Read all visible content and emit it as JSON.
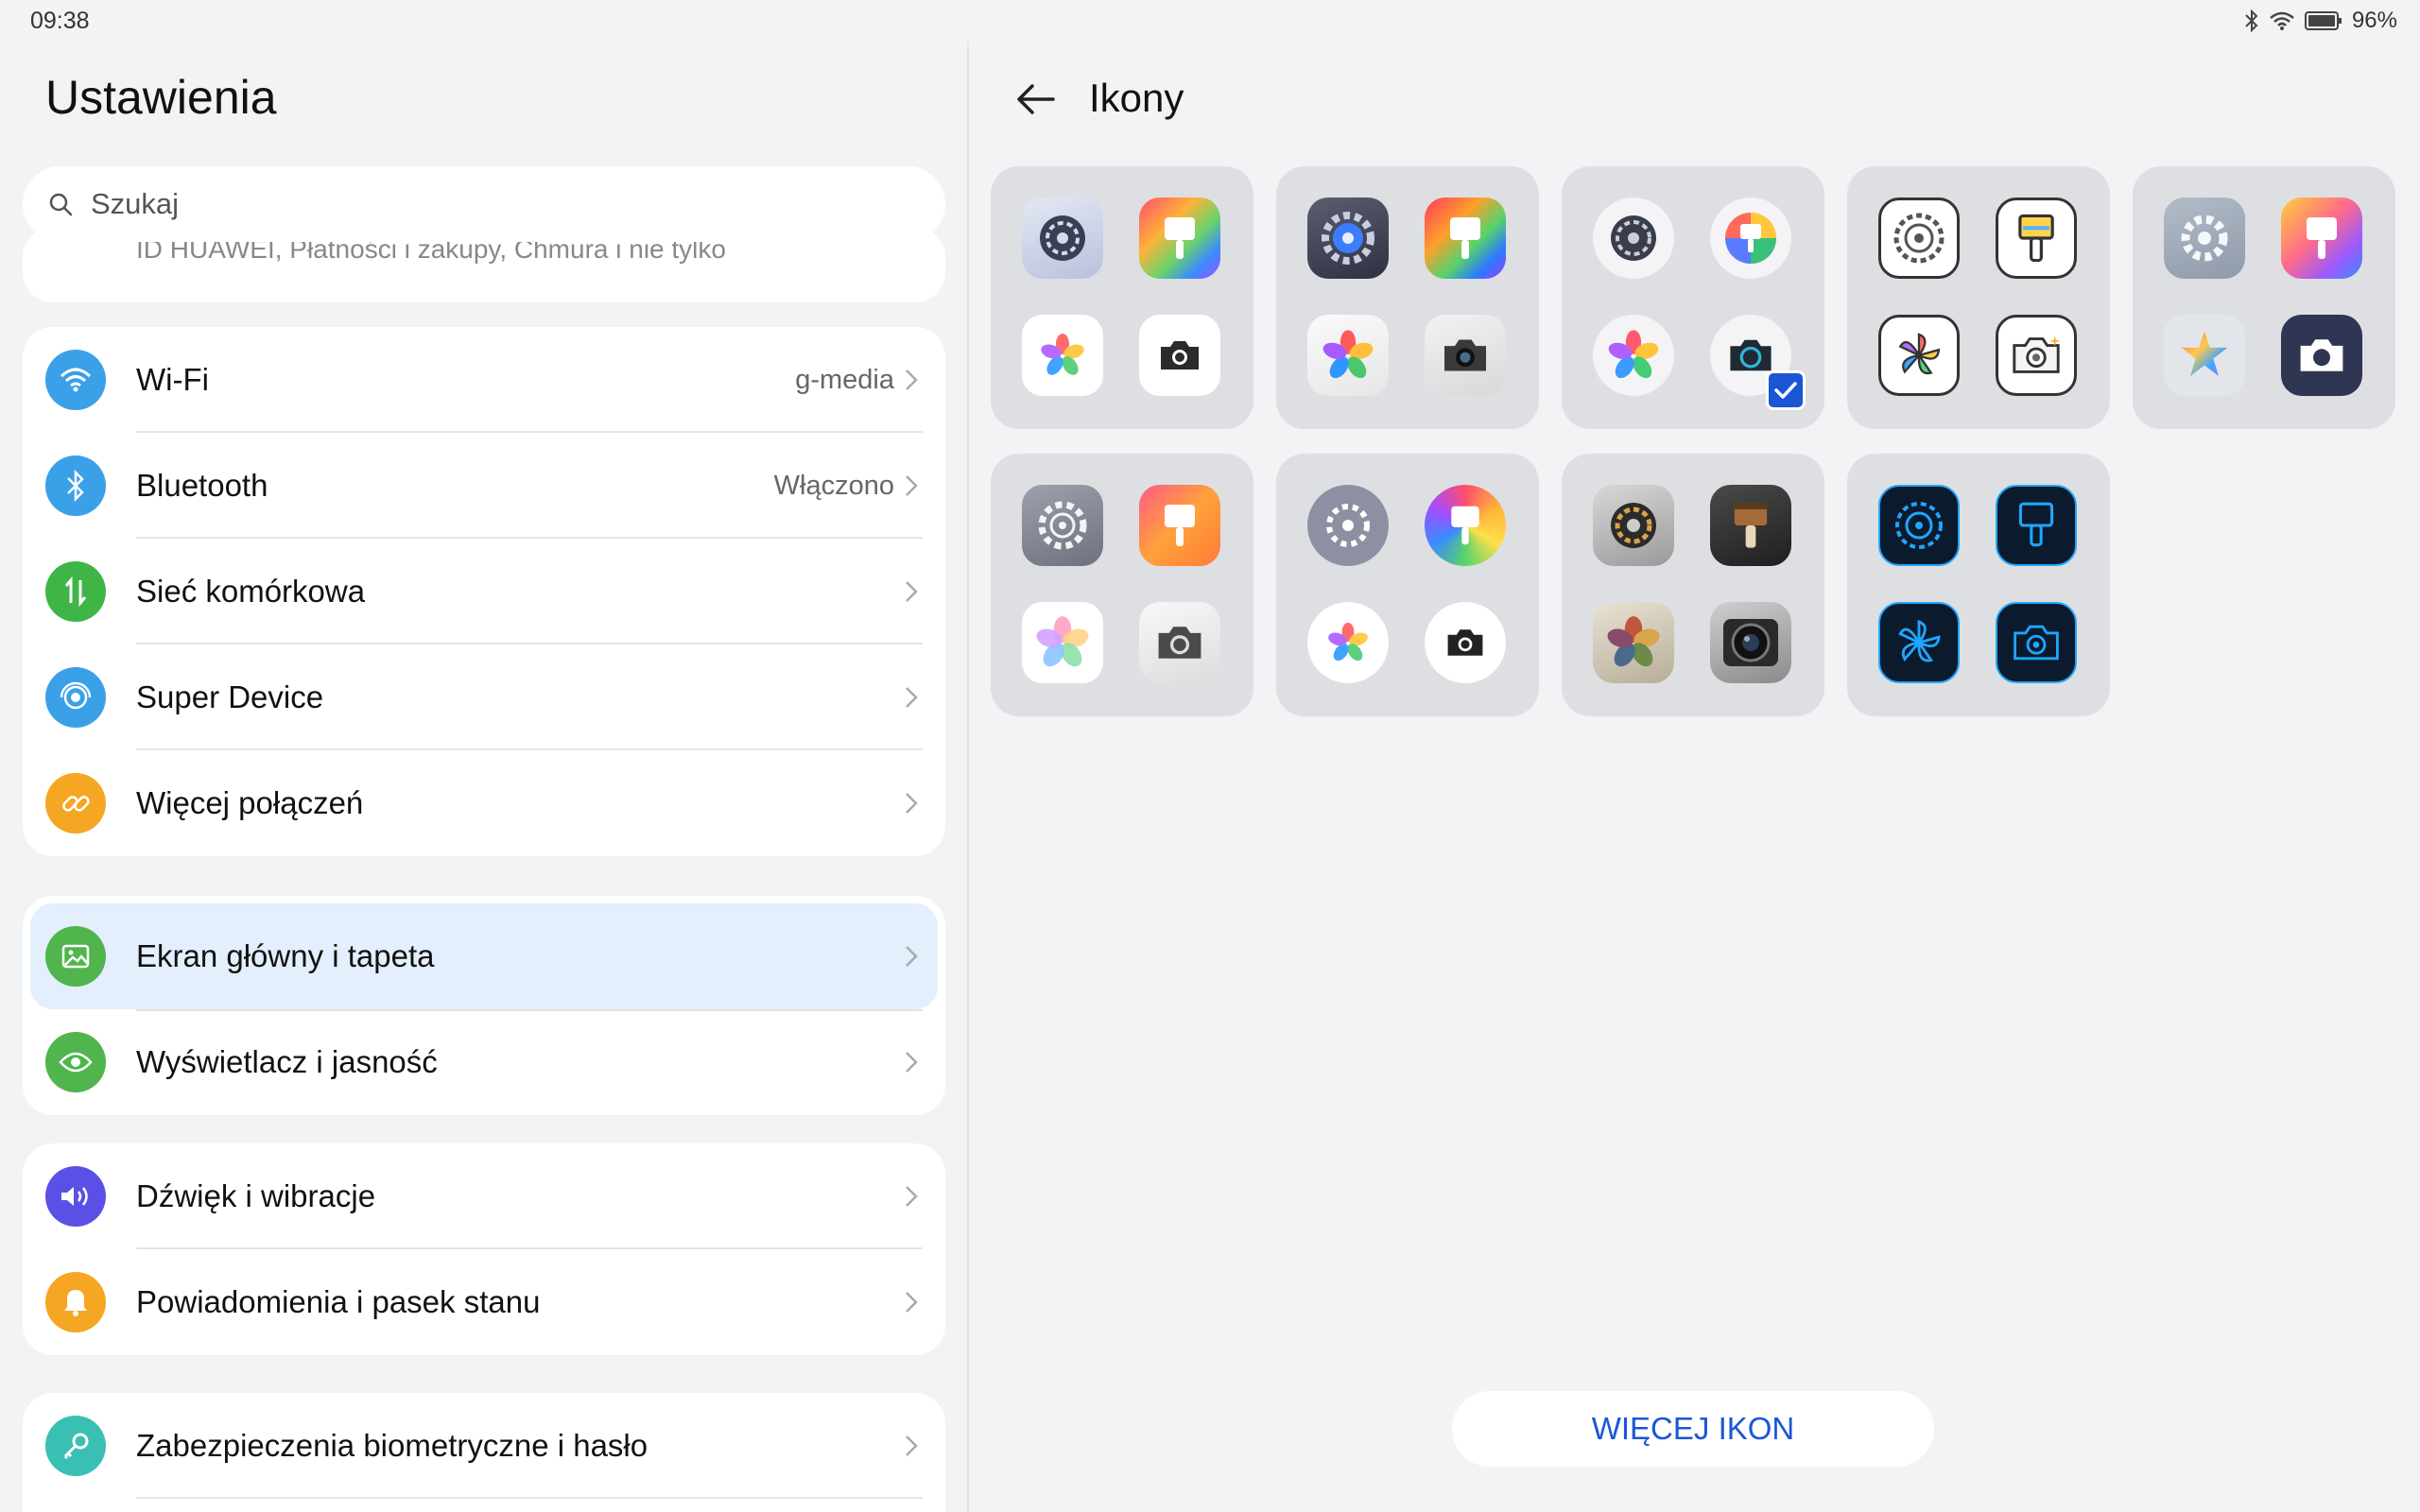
{
  "status": {
    "time": "09:38",
    "battery": "96%"
  },
  "left": {
    "title": "Ustawienia",
    "search_placeholder": "Szukaj",
    "peek_text": "ID HUAWEI, Płatności i zakupy, Chmura i nie tylko",
    "groups": [
      {
        "items": [
          {
            "label": "Wi-Fi",
            "value": "g-media",
            "icon": "wifi-icon",
            "color": "#3aa0e8"
          },
          {
            "label": "Bluetooth",
            "value": "Włączono",
            "icon": "bluetooth-icon",
            "color": "#3aa0e8"
          },
          {
            "label": "Sieć komórkowa",
            "value": "",
            "icon": "mobile-data-icon",
            "color": "#3fb548"
          },
          {
            "label": "Super Device",
            "value": "",
            "icon": "super-device-icon",
            "color": "#3aa0e8"
          },
          {
            "label": "Więcej połączeń",
            "value": "",
            "icon": "link-icon",
            "color": "#f5a623"
          }
        ]
      },
      {
        "items": [
          {
            "label": "Ekran główny i tapeta",
            "value": "",
            "icon": "wallpaper-icon",
            "color": "#4fb54c",
            "selected": true
          },
          {
            "label": "Wyświetlacz i jasność",
            "value": "",
            "icon": "eye-icon",
            "color": "#4fb54c"
          }
        ]
      },
      {
        "items": [
          {
            "label": "Dźwięk i wibracje",
            "value": "",
            "icon": "sound-icon",
            "color": "#5b50e6"
          },
          {
            "label": "Powiadomienia i pasek stanu",
            "value": "",
            "icon": "bell-icon",
            "color": "#f5a623"
          }
        ]
      },
      {
        "items": [
          {
            "label": "Zabezpieczenia biometryczne i hasło",
            "value": "",
            "icon": "key-icon",
            "color": "#39c0b2"
          }
        ]
      }
    ]
  },
  "right": {
    "title": "Ikony",
    "more_button": "WIĘCEJ IKON",
    "themes": [
      {
        "name": "theme-1",
        "icons": [
          "settings-gear-icon",
          "themes-brush-icon",
          "gallery-flower-icon",
          "camera-icon"
        ]
      },
      {
        "name": "theme-2",
        "icons": [
          "settings-gear-icon",
          "themes-brush-icon",
          "gallery-flower-icon",
          "camera-icon"
        ]
      },
      {
        "name": "theme-3",
        "icons": [
          "settings-gear-icon",
          "themes-brush-icon",
          "gallery-flower-icon",
          "camera-icon"
        ],
        "selected": true
      },
      {
        "name": "theme-4",
        "icons": [
          "settings-gear-icon",
          "themes-brush-icon",
          "gallery-flower-icon",
          "camera-icon"
        ]
      },
      {
        "name": "theme-5",
        "icons": [
          "settings-gear-icon",
          "themes-brush-icon",
          "gallery-flower-icon",
          "camera-icon"
        ]
      },
      {
        "name": "theme-6",
        "icons": [
          "settings-gear-icon",
          "themes-brush-icon",
          "gallery-flower-icon",
          "camera-icon"
        ]
      },
      {
        "name": "theme-7",
        "icons": [
          "settings-gear-icon",
          "themes-brush-icon",
          "gallery-flower-icon",
          "camera-icon"
        ]
      },
      {
        "name": "theme-8",
        "icons": [
          "settings-gear-icon",
          "themes-brush-icon",
          "gallery-flower-icon",
          "camera-icon"
        ]
      },
      {
        "name": "theme-9",
        "icons": [
          "settings-gear-icon",
          "themes-brush-icon",
          "gallery-flower-icon",
          "camera-icon"
        ]
      }
    ]
  },
  "colors": {
    "accent": "#1a56d6",
    "selected_row": "#e3effc",
    "background": "#f1f3f5"
  }
}
